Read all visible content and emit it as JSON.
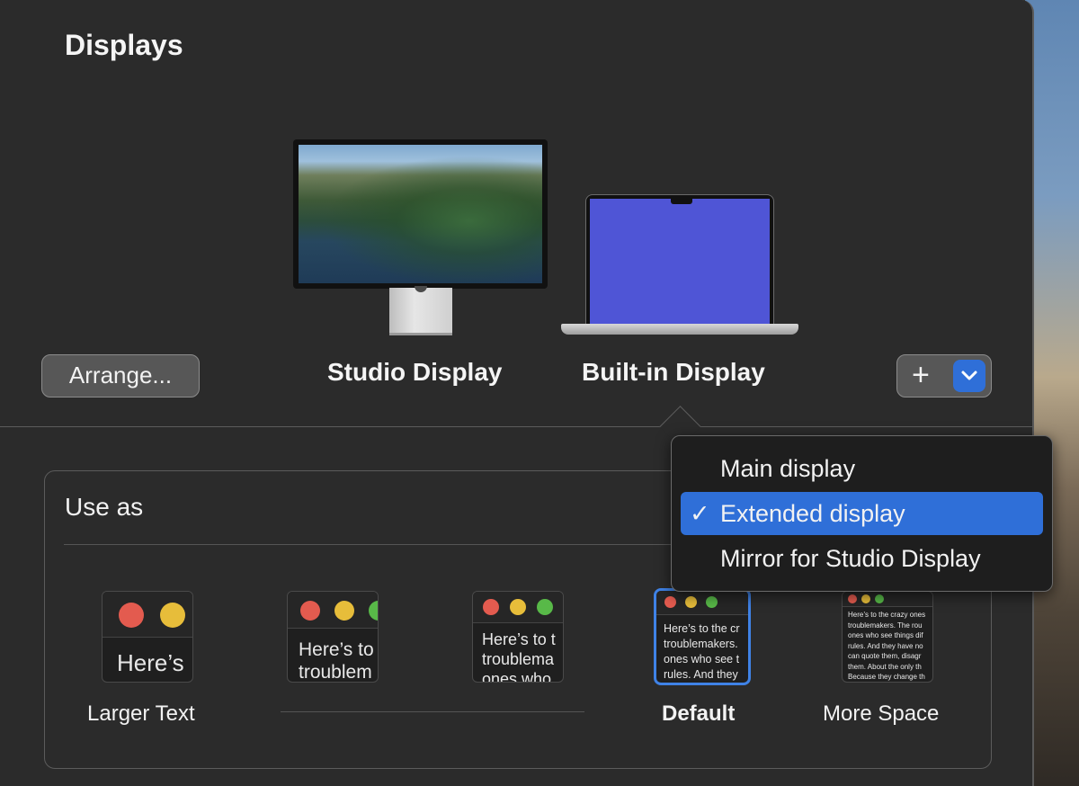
{
  "window": {
    "title": "Displays"
  },
  "displays": [
    {
      "name": "Studio Display"
    },
    {
      "name": "Built-in Display"
    }
  ],
  "toolbar": {
    "arrange_label": "Arrange...",
    "add_symbol": "+"
  },
  "use_as": {
    "label": "Use as",
    "menu": {
      "items": [
        {
          "label": "Main display",
          "checked": false
        },
        {
          "label": "Extended display",
          "checked": true
        },
        {
          "label": "Mirror for Studio Display",
          "checked": false
        }
      ],
      "check_symbol": "✓"
    }
  },
  "resolution_options": [
    {
      "label": "Larger Text",
      "preview_text": "Here’s",
      "selected": false
    },
    {
      "label": "",
      "preview_text": "Here’s to\ntroublem",
      "selected": false
    },
    {
      "label": "",
      "preview_text": "Here’s to t\ntroublema\nones who",
      "selected": false
    },
    {
      "label": "Default",
      "preview_text": "Here’s to the cr\ntroublemakers.\nones who see t\nrules. And they",
      "selected": true
    },
    {
      "label": "More Space",
      "preview_text": "Here’s to the crazy ones\ntroublemakers. The rou\nones who see things dif\nrules. And they have no\ncan quote them, disagr\nthem. About the only th\nBecause they change th",
      "selected": false
    }
  ],
  "icons": {
    "chevron": "chevron-down-icon",
    "plus": "plus-icon",
    "check": "checkmark-icon"
  },
  "colors": {
    "accent": "#2f6fd8",
    "laptop_screen": "#4f55d6"
  }
}
